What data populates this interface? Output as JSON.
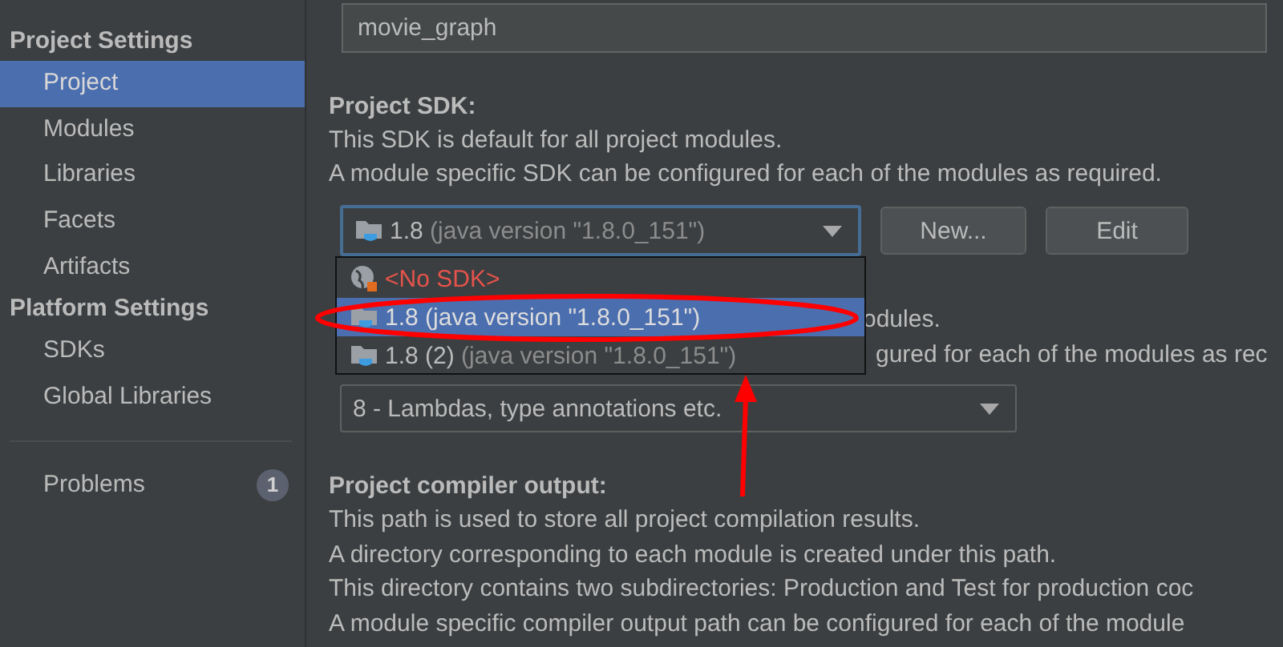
{
  "sidebar": {
    "sections": [
      {
        "title": "Project Settings",
        "items": [
          {
            "label": "Project",
            "selected": true
          },
          {
            "label": "Modules",
            "selected": false
          },
          {
            "label": "Libraries",
            "selected": false
          },
          {
            "label": "Facets",
            "selected": false
          },
          {
            "label": "Artifacts",
            "selected": false
          }
        ]
      },
      {
        "title": "Platform Settings",
        "items": [
          {
            "label": "SDKs",
            "selected": false
          },
          {
            "label": "Global Libraries",
            "selected": false
          }
        ]
      }
    ],
    "problems": {
      "label": "Problems",
      "count": "1"
    }
  },
  "project_name": {
    "value": "movie_graph"
  },
  "project_sdk": {
    "heading": "Project SDK:",
    "description": [
      "This SDK is default for all project modules.",
      "A module specific SDK can be configured for each of the modules as required."
    ],
    "combo": {
      "name": "1.8",
      "detail": "(java version \"1.8.0_151\")"
    },
    "buttons": [
      "New...",
      "Edit"
    ],
    "popup": [
      {
        "kind": "none",
        "name": "<No SDK>",
        "selected": false
      },
      {
        "kind": "jdk",
        "name": "1.8",
        "detail": "(java version \"1.8.0_151\")",
        "selected": true
      },
      {
        "kind": "jdk",
        "name": "1.8 (2)",
        "detail": "(java version \"1.8.0_151\")",
        "selected": false
      }
    ]
  },
  "language_level": {
    "description_fragments": [
      {
        "after": "odules."
      },
      {
        "after": "gured for each of the modules as rec"
      }
    ],
    "combo": {
      "value": "8 - Lambdas, type annotations etc."
    }
  },
  "compiler_output": {
    "heading": "Project compiler output:",
    "description": [
      "This path is used to store all project compilation results.",
      "A directory corresponding to each module is created under this path.",
      "This directory contains two subdirectories: Production and Test for production coc",
      "A module specific compiler output path can be configured for each of the module"
    ]
  }
}
